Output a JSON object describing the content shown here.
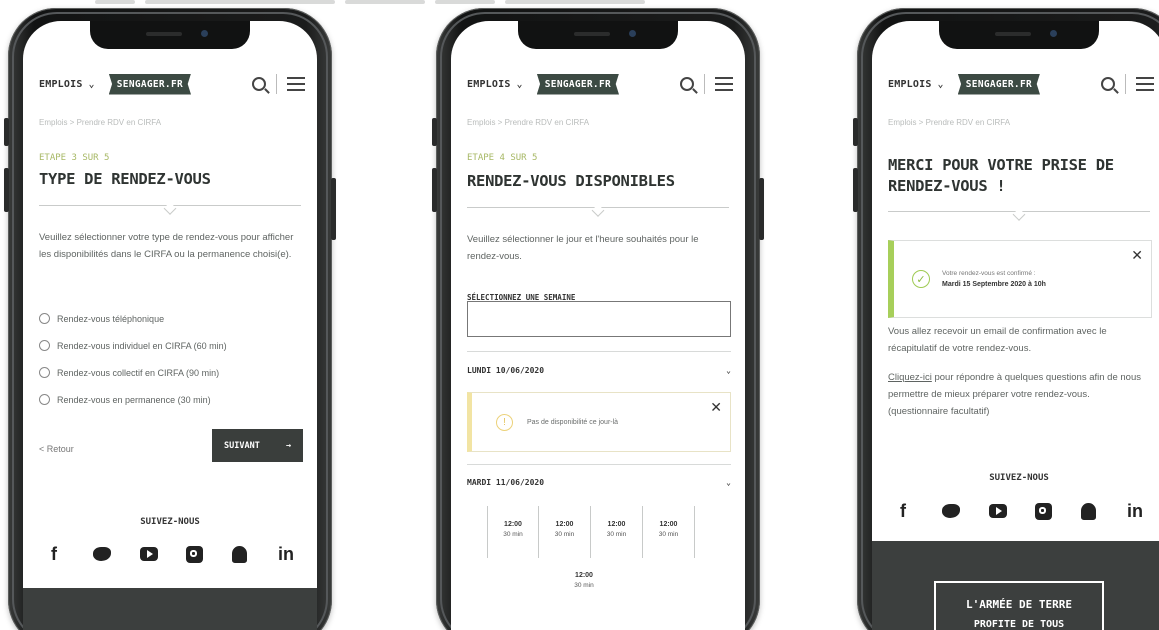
{
  "header": {
    "emplois_label": "EMPLOIS",
    "logo_text": "SENGAGER.FR"
  },
  "breadcrumb": "Emplois > Prendre RDV en CIRFA",
  "follow_label": "SUIVEZ-NOUS",
  "social_icons": [
    "facebook-icon",
    "twitter-icon",
    "youtube-icon",
    "instagram-icon",
    "snapchat-icon",
    "linkedin-icon"
  ],
  "screen1": {
    "step": "ETAPE 3 SUR 5",
    "title": "TYPE DE RENDEZ-VOUS",
    "intro": "Veuillez sélectionner votre type de rendez-vous pour afficher les disponibilités dans le CIRFA ou la permanence choisi(e).",
    "options": [
      "Rendez-vous téléphonique",
      "Rendez-vous individuel en CIRFA (60 min)",
      "Rendez-vous collectif en CIRFA (90 min)",
      "Rendez-vous en permanence (30 min)"
    ],
    "back_label": "< Retour",
    "next_label": "SUIVANT"
  },
  "screen2": {
    "step": "ETAPE 4 SUR 5",
    "title": "RENDEZ-VOUS DISPONIBLES",
    "intro": "Veuillez sélectionner le jour et l'heure souhaités pour le rendez-vous.",
    "week_label": "SÉLECTIONNEZ UNE SEMAINE",
    "day1": "LUNDI 10/06/2020",
    "warning": "Pas de disponibilité ce jour-là",
    "day2": "MARDI 11/06/2020",
    "slots": [
      {
        "time": "12:00",
        "duration": "30 min"
      },
      {
        "time": "12:00",
        "duration": "30 min"
      },
      {
        "time": "12:00",
        "duration": "30 min"
      },
      {
        "time": "12:00",
        "duration": "30 min"
      },
      {
        "time": "12:00",
        "duration": "30 min"
      }
    ]
  },
  "screen3": {
    "title": "MERCI POUR VOTRE PRISE DE RENDEZ-VOUS !",
    "confirm_line1": "Votre rendez-vous est confirmé :",
    "confirm_line2": "Mardi 15 Septembre 2020 à 10h",
    "email_text": "Vous allez recevoir un email de confirmation avec le récapitulatif de votre rendez-vous.",
    "link_text": "Cliquez-ici",
    "questions_text": " pour répondre à quelques questions afin de nous permettre de mieux préparer votre rendez-vous. (questionnaire facultatif)",
    "footer_title": "L'ARMÉE DE TERRE",
    "footer_sub": "PROFITE DE TOUS"
  }
}
